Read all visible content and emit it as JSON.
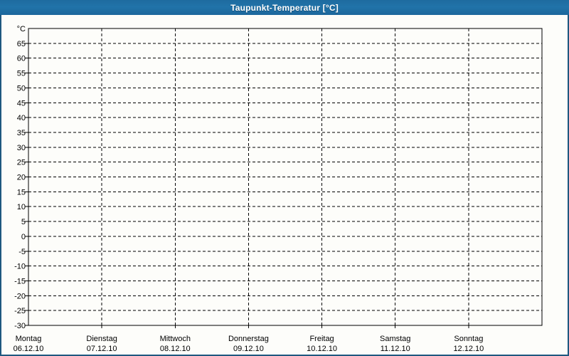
{
  "window": {
    "title": "Taupunkt-Temperatur [°C]"
  },
  "colors": {
    "titlebar_bg_top": "#1E6B9F",
    "titlebar_bg_mid": "#2173A9",
    "titlebar_bg_bottom": "#1C679C",
    "titlebar_text": "#FFFFFF",
    "frame_border": "#1F5880",
    "plot_border": "#000000",
    "gridline": "#000000",
    "background": "#FDFDFA",
    "label_text": "#000000"
  },
  "chart_data": {
    "type": "line",
    "title": "Taupunkt-Temperatur [°C]",
    "ylabel": "°C",
    "y_axis": {
      "min": -30,
      "max": 70,
      "step": 5,
      "unit_label": "°C",
      "tick_labels": [
        "°C",
        "65",
        "60",
        "55",
        "50",
        "45",
        "40",
        "35",
        "30",
        "25",
        "20",
        "15",
        "10",
        "5",
        "0",
        "-5",
        "-10",
        "-15",
        "-20",
        "-25",
        "-30"
      ]
    },
    "x_axis": {
      "categories": [
        {
          "name": "Montag",
          "date": "06.12.10"
        },
        {
          "name": "Dienstag",
          "date": "07.12.10"
        },
        {
          "name": "Mittwoch",
          "date": "08.12.10"
        },
        {
          "name": "Donnerstag",
          "date": "09.12.10"
        },
        {
          "name": "Freitag",
          "date": "10.12.10"
        },
        {
          "name": "Samstag",
          "date": "11.12.10"
        },
        {
          "name": "Sonntag",
          "date": "12.12.10"
        }
      ]
    },
    "grid": {
      "horizontal_dashed": true,
      "vertical_dashed": true
    },
    "legend": "none",
    "series": []
  }
}
